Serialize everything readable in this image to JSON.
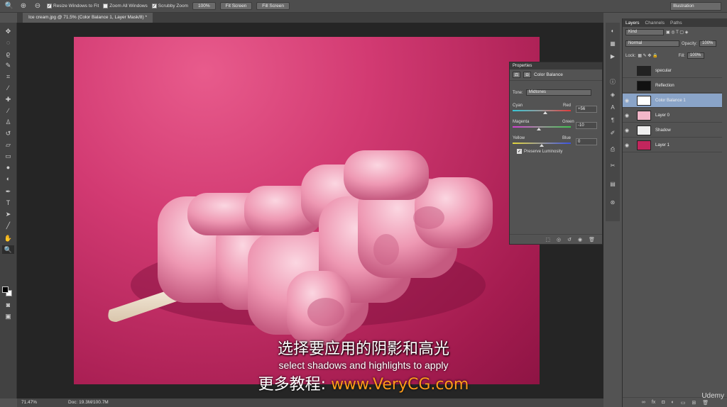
{
  "options_bar": {
    "resize_windows": "Resize Windows to Fit",
    "zoom_all_windows": "Zoom All Windows",
    "scrubby_zoom": "Scrubby Zoom",
    "btn_100": "100%",
    "btn_fit": "Fit Screen",
    "btn_fill": "Fill Screen",
    "workspace": "Illustration"
  },
  "document": {
    "tab_title": "Ice cream.jpg @ 71.5% (Color Balance 1, Layer Mask/8) *",
    "zoom": "71.47%",
    "doc_size": "Doc: 19.3M/100.7M"
  },
  "properties": {
    "header": "Properties",
    "title": "Color Balance",
    "tone_label": "Tone:",
    "tone_value": "Midtones",
    "sliders": [
      {
        "left": "Cyan",
        "right": "Red",
        "value": "+56",
        "position": 0.56,
        "colors": [
          "#35c6d6",
          "#e23a3a"
        ]
      },
      {
        "left": "Magenta",
        "right": "Green",
        "value": "-10",
        "position": 0.45,
        "colors": [
          "#d43ed4",
          "#3ec64e"
        ]
      },
      {
        "left": "Yellow",
        "right": "Blue",
        "value": "0",
        "position": 0.5,
        "colors": [
          "#e2d63a",
          "#3a52e2"
        ]
      }
    ],
    "preserve_luminosity": "Preserve Luminosity"
  },
  "layers_panel": {
    "tabs": [
      "Layers",
      "Channels",
      "Paths"
    ],
    "kind": "Kind",
    "blend_mode": "Normal",
    "opacity_label": "Opacity:",
    "opacity_value": "100%",
    "lock_label": "Lock:",
    "fill_label": "Fill:",
    "fill_value": "100%",
    "layers": [
      {
        "name": "specular",
        "visible": false,
        "active": false,
        "thumb": "#222"
      },
      {
        "name": "Reflection",
        "visible": false,
        "active": false,
        "thumb": "#111"
      },
      {
        "name": "Color Balance 1",
        "visible": true,
        "active": true,
        "thumb": "#fff"
      },
      {
        "name": "Layer 0",
        "visible": true,
        "active": false,
        "thumb": "#f3b7c9"
      },
      {
        "name": "Shadow",
        "visible": true,
        "active": false,
        "thumb": "#eee"
      },
      {
        "name": "Layer 1",
        "visible": true,
        "active": false,
        "thumb": "#c2265d"
      }
    ]
  },
  "subtitles": {
    "chinese": "选择要应用的阴影和高光",
    "english": "select shadows and highlights to apply",
    "promo_cn": "更多教程:",
    "promo_url": "www.VeryCG.com"
  },
  "watermark": "Udemy"
}
